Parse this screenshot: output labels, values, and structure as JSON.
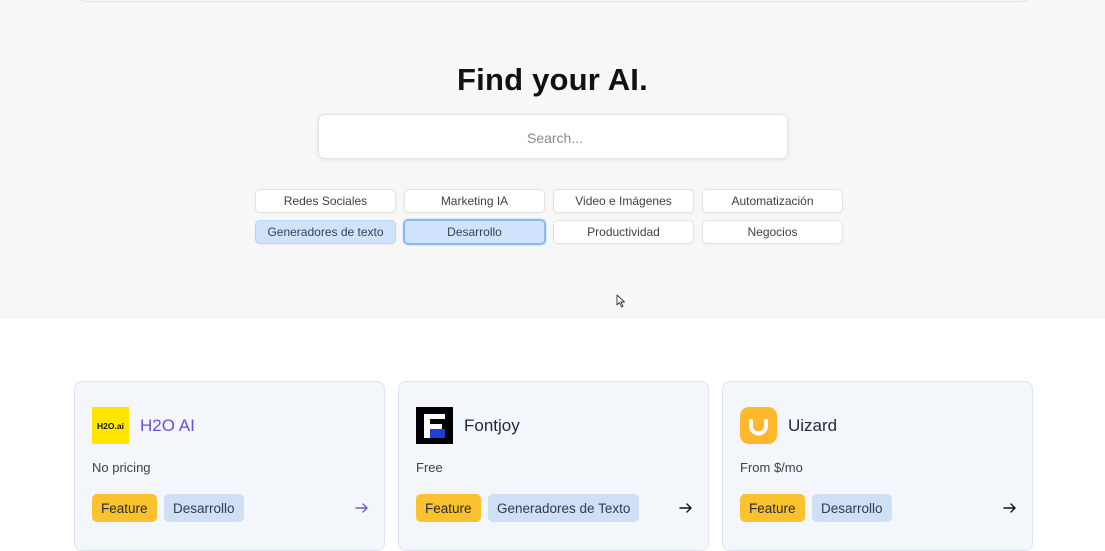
{
  "hero": {
    "title": "Find your AI.",
    "search_placeholder": "Search..."
  },
  "categories": [
    {
      "label": "Redes Sociales",
      "selected": false
    },
    {
      "label": "Marketing IA",
      "selected": false
    },
    {
      "label": "Video e Imágenes",
      "selected": false
    },
    {
      "label": "Automatización",
      "selected": false
    },
    {
      "label": "Generadores de texto",
      "selected": true
    },
    {
      "label": "Desarrollo",
      "selected": true
    },
    {
      "label": "Productividad",
      "selected": false
    },
    {
      "label": "Negocios",
      "selected": false
    }
  ],
  "cards": [
    {
      "name": "H2O AI",
      "logo_text": "H2O.ai",
      "logo_color": "#ffe500",
      "icon": "h2o-logo-icon",
      "pricing": "No pricing",
      "tags": [
        "Feature",
        "Desarrollo"
      ]
    },
    {
      "name": "Fontjoy",
      "logo_text": "F",
      "logo_color": "#000000",
      "icon": "fontjoy-logo-icon",
      "pricing": "Free",
      "tags": [
        "Feature",
        "Generadores de Texto"
      ]
    },
    {
      "name": "Uizard",
      "logo_text": "U",
      "logo_color": "#ffb72b",
      "icon": "uizard-logo-icon",
      "pricing": "From $/mo",
      "tags": [
        "Feature",
        "Desarrollo"
      ]
    }
  ],
  "colors": {
    "accent": "#6d4fd6",
    "feature_tag": "#f9c22e",
    "category_tag": "#cfe0f4",
    "selected_chip": "#cfe3fa"
  }
}
